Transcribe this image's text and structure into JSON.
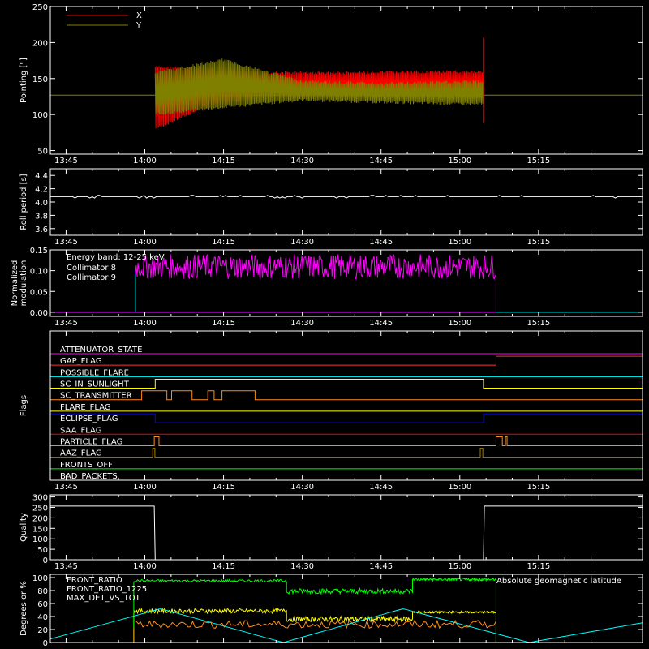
{
  "time_ticks": [
    "13:45",
    "14:00",
    "14:15",
    "14:30",
    "14:45",
    "15:00",
    "15:15"
  ],
  "chart_data": [
    {
      "type": "line",
      "ylabel": "Pointing [\"]",
      "ylim": [
        45,
        250
      ],
      "yticks": [
        50,
        100,
        150,
        200,
        250
      ],
      "legend": "top-left",
      "series": [
        {
          "name": "X",
          "color": "#ff0000",
          "band": [
            [
              14.033,
              78,
              168
            ],
            [
              14.2,
              110,
              165
            ],
            [
              14.4,
              125,
              160
            ],
            [
              14.6,
              125,
              160
            ],
            [
              15.075,
              125,
              162
            ]
          ]
        },
        {
          "name": "Y",
          "color": "#808000",
          "band": [
            [
              14.033,
              98,
              160
            ],
            [
              14.25,
              108,
              178
            ],
            [
              14.5,
              118,
              148
            ],
            [
              14.75,
              115,
              145
            ],
            [
              15.075,
              112,
              148
            ]
          ]
        }
      ],
      "hline": 127,
      "spikes": {
        "start": 14.033,
        "end": 15.075,
        "end_high": 207,
        "end_low": 88
      }
    },
    {
      "type": "line",
      "ylabel": "Roll period [s]",
      "ylim": [
        3.5,
        4.5
      ],
      "yticks": [
        "3.6",
        "3.8",
        "4.0",
        "4.2",
        "4.4"
      ],
      "value": 4.08,
      "color": "#ffffff"
    },
    {
      "type": "line",
      "ylabel": "Normalized modulation",
      "ylim": [
        -0.01,
        0.15
      ],
      "yticks": [
        "0.00",
        "0.05",
        "0.10",
        "0.15"
      ],
      "legend": "top-left",
      "annotation": "Energy band: 12-25 keV",
      "window": [
        13.97,
        15.115
      ],
      "series": [
        {
          "name": "Collimator 8",
          "color": "#00ffff",
          "level": 0.0
        },
        {
          "name": "Collimator 9",
          "color": "#ff00ff",
          "level": 0.11
        }
      ]
    },
    {
      "type": "line",
      "ylabel": "Flags",
      "series": [
        {
          "name": "ATTENUATOR_STATE",
          "color": "#ff00ff",
          "on": []
        },
        {
          "name": "GAP_FLAG",
          "color": "#ff3030",
          "on": [
            [
              15.115,
              15.6
            ]
          ]
        },
        {
          "name": "POSSIBLE_FLARE",
          "color": "#00ffff",
          "on": []
        },
        {
          "name": "SC_IN_SUNLIGHT",
          "color": "#ffff00",
          "on": [
            [
              14.033,
              15.075
            ]
          ]
        },
        {
          "name": "SC_TRANSMITTER",
          "color": "#ff8c1a",
          "on": [
            [
              13.99,
              14.07
            ],
            [
              14.085,
              14.15
            ],
            [
              14.2,
              14.22
            ],
            [
              14.245,
              14.35
            ]
          ]
        },
        {
          "name": "FLARE_FLAG",
          "color": "#ffff00",
          "on": []
        },
        {
          "name": "ECLIPSE_FLAG",
          "color": "#0000ff",
          "on": [
            [
              13.5,
              14.033
            ],
            [
              15.075,
              15.6
            ]
          ]
        },
        {
          "name": "SAA_FLAG",
          "color": "#ff0000",
          "on": []
        },
        {
          "name": "PARTICLE_FLAG",
          "color": "#ff8c1a",
          "on": [
            [
              14.03,
              14.045
            ],
            [
              15.115,
              15.135
            ],
            [
              15.145,
              15.15
            ]
          ]
        },
        {
          "name": "AAZ_FLAG",
          "color": "#a08000",
          "on": [
            [
              14.025,
              14.032
            ],
            [
              15.065,
              15.073
            ]
          ]
        },
        {
          "name": "FRONTS_OFF",
          "color": "#00ff00",
          "on": []
        },
        {
          "name": "BAD_PACKETS",
          "color": "#ff0000",
          "on": []
        }
      ]
    },
    {
      "type": "line",
      "ylabel": "Quality",
      "ylim": [
        0,
        310
      ],
      "yticks": [
        0,
        50,
        100,
        150,
        200,
        250,
        300
      ],
      "color": "#ffffff",
      "levels": [
        [
          13.5,
          256
        ],
        [
          14.03,
          256
        ],
        [
          14.033,
          0
        ],
        [
          15.075,
          0
        ],
        [
          15.078,
          256
        ],
        [
          15.6,
          256
        ]
      ]
    },
    {
      "type": "line",
      "ylabel": "Degrees or %",
      "ylim": [
        0,
        105
      ],
      "yticks": [
        0,
        20,
        40,
        60,
        80,
        100
      ],
      "legend": "top-left",
      "annotation": "Absolute geomagnetic latitude",
      "annotation_color": "#00ffff",
      "series": [
        {
          "name": "FRONT_RATIO",
          "color": "#ffff00",
          "segments": [
            [
              13.965,
              14.45,
              45,
              52
            ],
            [
              14.45,
              14.85,
              32,
              40
            ],
            [
              14.85,
              15.115,
              45,
              48
            ]
          ]
        },
        {
          "name": "FRONT_RATIO_1225",
          "color": "#00ff00",
          "segments": [
            [
              13.965,
              14.45,
              93,
              97
            ],
            [
              14.45,
              14.85,
              75,
              83
            ],
            [
              14.85,
              15.115,
              95,
              99
            ]
          ]
        },
        {
          "name": "MAX_DET_VS_TOT",
          "color": "#ff8c1a",
          "segments": [
            [
              13.965,
              15.115,
              22,
              34
            ]
          ]
        },
        {
          "name": "Absolute geomagnetic latitude",
          "color": "#00ffff",
          "points": [
            [
              13.5,
              32
            ],
            [
              13.66,
              0
            ],
            [
              14.05,
              52
            ],
            [
              14.44,
              0
            ],
            [
              14.82,
              52
            ],
            [
              15.22,
              0
            ],
            [
              15.6,
              32
            ]
          ]
        }
      ]
    }
  ]
}
